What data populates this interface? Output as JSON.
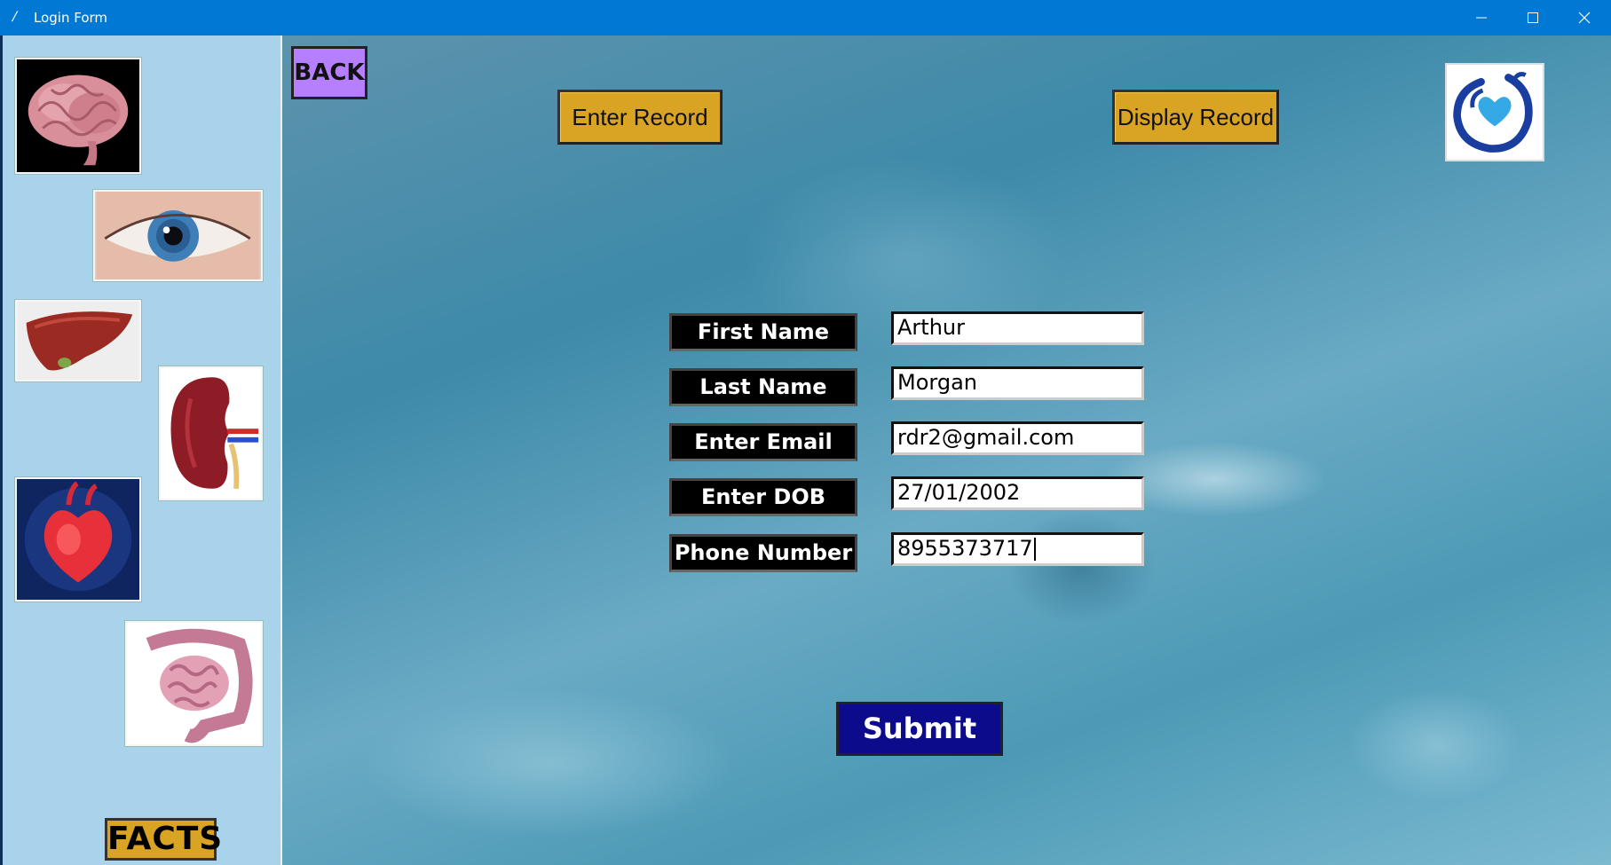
{
  "window": {
    "title": "Login Form",
    "controls": [
      "minimize",
      "maximize",
      "close"
    ]
  },
  "sidebar": {
    "images": [
      "brain",
      "eye",
      "liver",
      "kidney",
      "heart",
      "intestines"
    ],
    "facts_label": "FACTS"
  },
  "toolbar": {
    "back_label": "BACK",
    "enter_record_label": "Enter Record",
    "display_record_label": "Display Record"
  },
  "form": {
    "fields": [
      {
        "label": "First Name",
        "value": "Arthur"
      },
      {
        "label": "Last Name",
        "value": "Morgan"
      },
      {
        "label": "Enter Email",
        "value": "rdr2@gmail.com"
      },
      {
        "label": "Enter DOB",
        "value": "27/01/2002"
      },
      {
        "label": "Phone Number",
        "value": "8955373717"
      }
    ],
    "submit_label": "Submit"
  },
  "colors": {
    "titlebar": "#0078d4",
    "sidebar": "#a9d3ea",
    "gold_button": "#d9a324",
    "back_button": "#b57fff",
    "submit_button": "#0b0b8c",
    "label_bg": "#000000"
  }
}
